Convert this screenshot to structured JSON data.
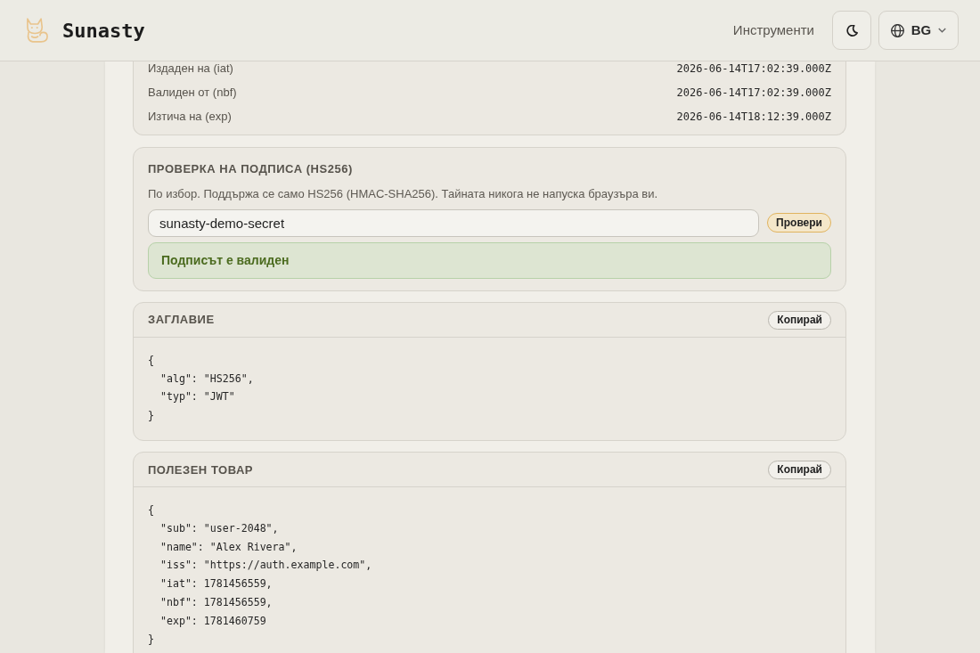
{
  "header": {
    "brand": "Sunasty",
    "nav_link": "Инструменти",
    "language": "BG"
  },
  "claims": [
    {
      "label": "Издаден на (iat)",
      "value": "2026-06-14T17:02:39.000Z"
    },
    {
      "label": "Валиден от (nbf)",
      "value": "2026-06-14T17:02:39.000Z"
    },
    {
      "label": "Изтича на (exp)",
      "value": "2026-06-14T18:12:39.000Z"
    }
  ],
  "signature": {
    "title": "ПРОВЕРКА НА ПОДПИСА (HS256)",
    "note": "По избор. Поддържа се само HS256 (HMAC-SHA256). Тайната никога не напуска браузъра ви.",
    "secret": "sunasty-demo-secret",
    "verify_button": "Провери",
    "result": {
      "kind": "valid",
      "text": "Подписът е валиден"
    }
  },
  "sections": [
    {
      "title": "ЗАГЛАВИЕ",
      "copy_button": "Копирай",
      "code": "{\n  \"alg\": \"HS256\",\n  \"typ\": \"JWT\"\n}"
    },
    {
      "title": "ПОЛЕЗЕН ТОВАР",
      "copy_button": "Копирай",
      "code": "{\n  \"sub\": \"user-2048\",\n  \"name\": \"Alex Rivera\",\n  \"iss\": \"https://auth.example.com\",\n  \"iat\": 1781456559,\n  \"nbf\": 1781456559,\n  \"exp\": 1781460759\n}"
    }
  ]
}
